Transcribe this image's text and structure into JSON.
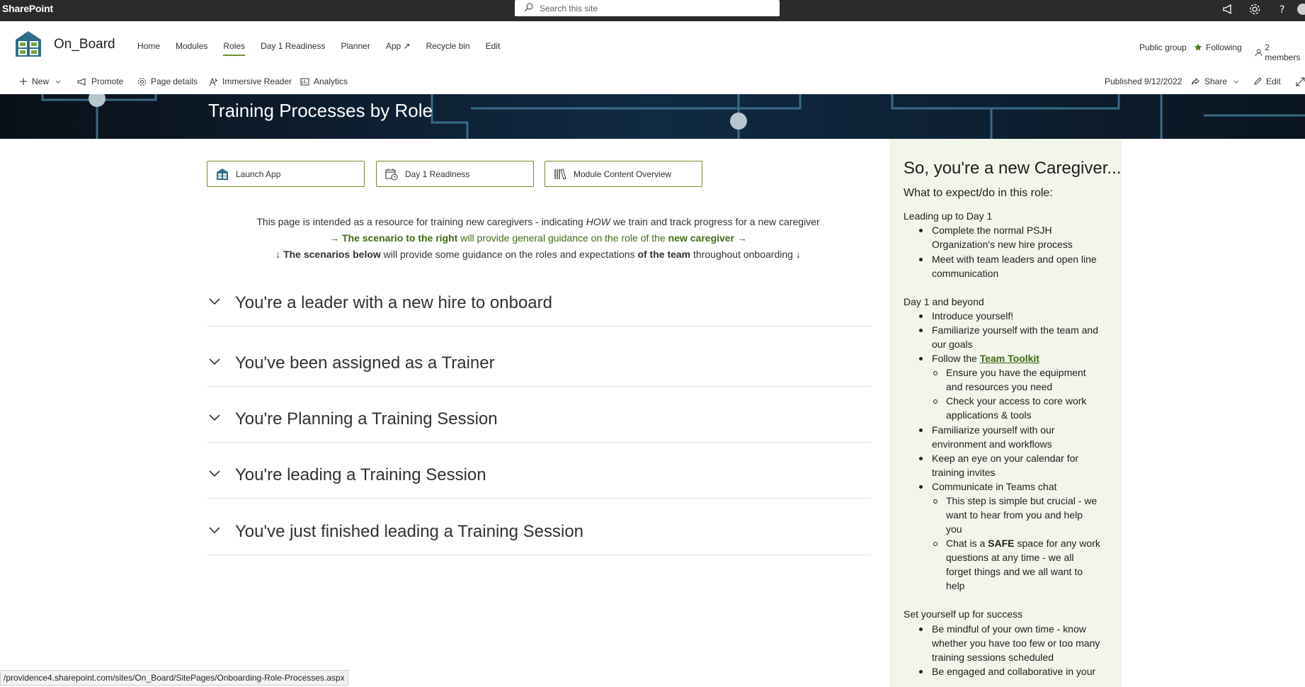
{
  "suitebar": {
    "app_name": "SharePoint",
    "search_placeholder": "Search this site"
  },
  "site": {
    "title": "On_Board",
    "nav": [
      "Home",
      "Modules",
      "Roles",
      "Day 1 Readiness",
      "Planner",
      "App ↗",
      "Recycle bin",
      "Edit"
    ],
    "active_nav": "Roles",
    "group_type": "Public group",
    "following": "Following",
    "members": "2 members"
  },
  "commandbar": {
    "new": "New",
    "promote": "Promote",
    "page_details": "Page details",
    "immersive_reader": "Immersive Reader",
    "analytics": "Analytics",
    "published": "Published 9/12/2022",
    "share": "Share",
    "edit": "Edit"
  },
  "banner": {
    "title": "Training Processes by Role"
  },
  "quick_links": [
    "Launch App",
    "Day 1 Readiness",
    "Module Content Overview"
  ],
  "intro": {
    "line1_a": "This page is intended as a resource for training new caregivers - indicating ",
    "line1_em": "HOW",
    "line1_b": " we train and track progress for a new caregiver",
    "line2_arrow_l": "→",
    "line2_bold1": "The scenario to the right",
    "line2_mid": " will provide general guidance on the role of the ",
    "line2_bold2": "new caregiver",
    "line2_arrow_r": "→",
    "line3_arrow_l": "↓",
    "line3_bold1": "The scenarios below",
    "line3_mid": " will provide some guidance on the roles and expectations ",
    "line3_bold2": "of the team",
    "line3_end": " throughout onboarding ",
    "line3_arrow_r": "↓"
  },
  "accordion": [
    "You're a leader with a new hire to onboard",
    "You've been assigned as a Trainer",
    "You're Planning a Training Session",
    "You're leading a Training Session",
    "You've just finished leading a Training Session"
  ],
  "panel": {
    "title": "So, you're a new Caregiver...",
    "subtitle": "What to expect/do in this role:",
    "sec1": "Leading up to Day 1",
    "sec1_items": [
      [
        "Complete the normal PSJH",
        "Organization's new hire process"
      ],
      [
        "Meet with team leaders and open line",
        "communication"
      ]
    ],
    "sec2": "Day 1 and beyond",
    "introduce": "Introduce yourself!",
    "familiar_team": [
      "Familiarize yourself with the team and",
      "our goals"
    ],
    "follow_prefix": "Follow the ",
    "toolkit_link": "Team Toolkit",
    "toolkit_sub": [
      [
        "Ensure you have the equipment",
        "and resources you need"
      ],
      [
        "Check your access to core work",
        "applications & tools"
      ]
    ],
    "familiar_env": [
      "Familiarize yourself with our",
      "environment and workflows"
    ],
    "calendar": [
      "Keep an eye on your calendar for",
      "training invites"
    ],
    "communicate": "Communicate in Teams chat",
    "chat_sub1": [
      "This step is simple but crucial - we",
      "want to hear from you and help",
      "you"
    ],
    "chat_sub2_a": "Chat is a ",
    "chat_sub2_bold": "SAFE",
    "chat_sub2_b": " space for any work",
    "chat_sub2_rest": [
      "questions at any time - we all",
      "forget things and we all want to",
      "help"
    ],
    "sec3": "Set yourself up for success",
    "mindful": [
      "Be mindful of your own time - know",
      "whether you have too few or too many",
      "training sessions scheduled"
    ],
    "engaged": "Be engaged and collaborative in your"
  },
  "status_url": "/providence4.sharepoint.com/sites/On_Board/SitePages/Onboarding-Role-Processes.aspx",
  "colors": {
    "suitebar": "#2b2b2b",
    "accent": "#6f8f2b",
    "panel_bg": "#f1f5ea",
    "link": "#3f6b14"
  }
}
